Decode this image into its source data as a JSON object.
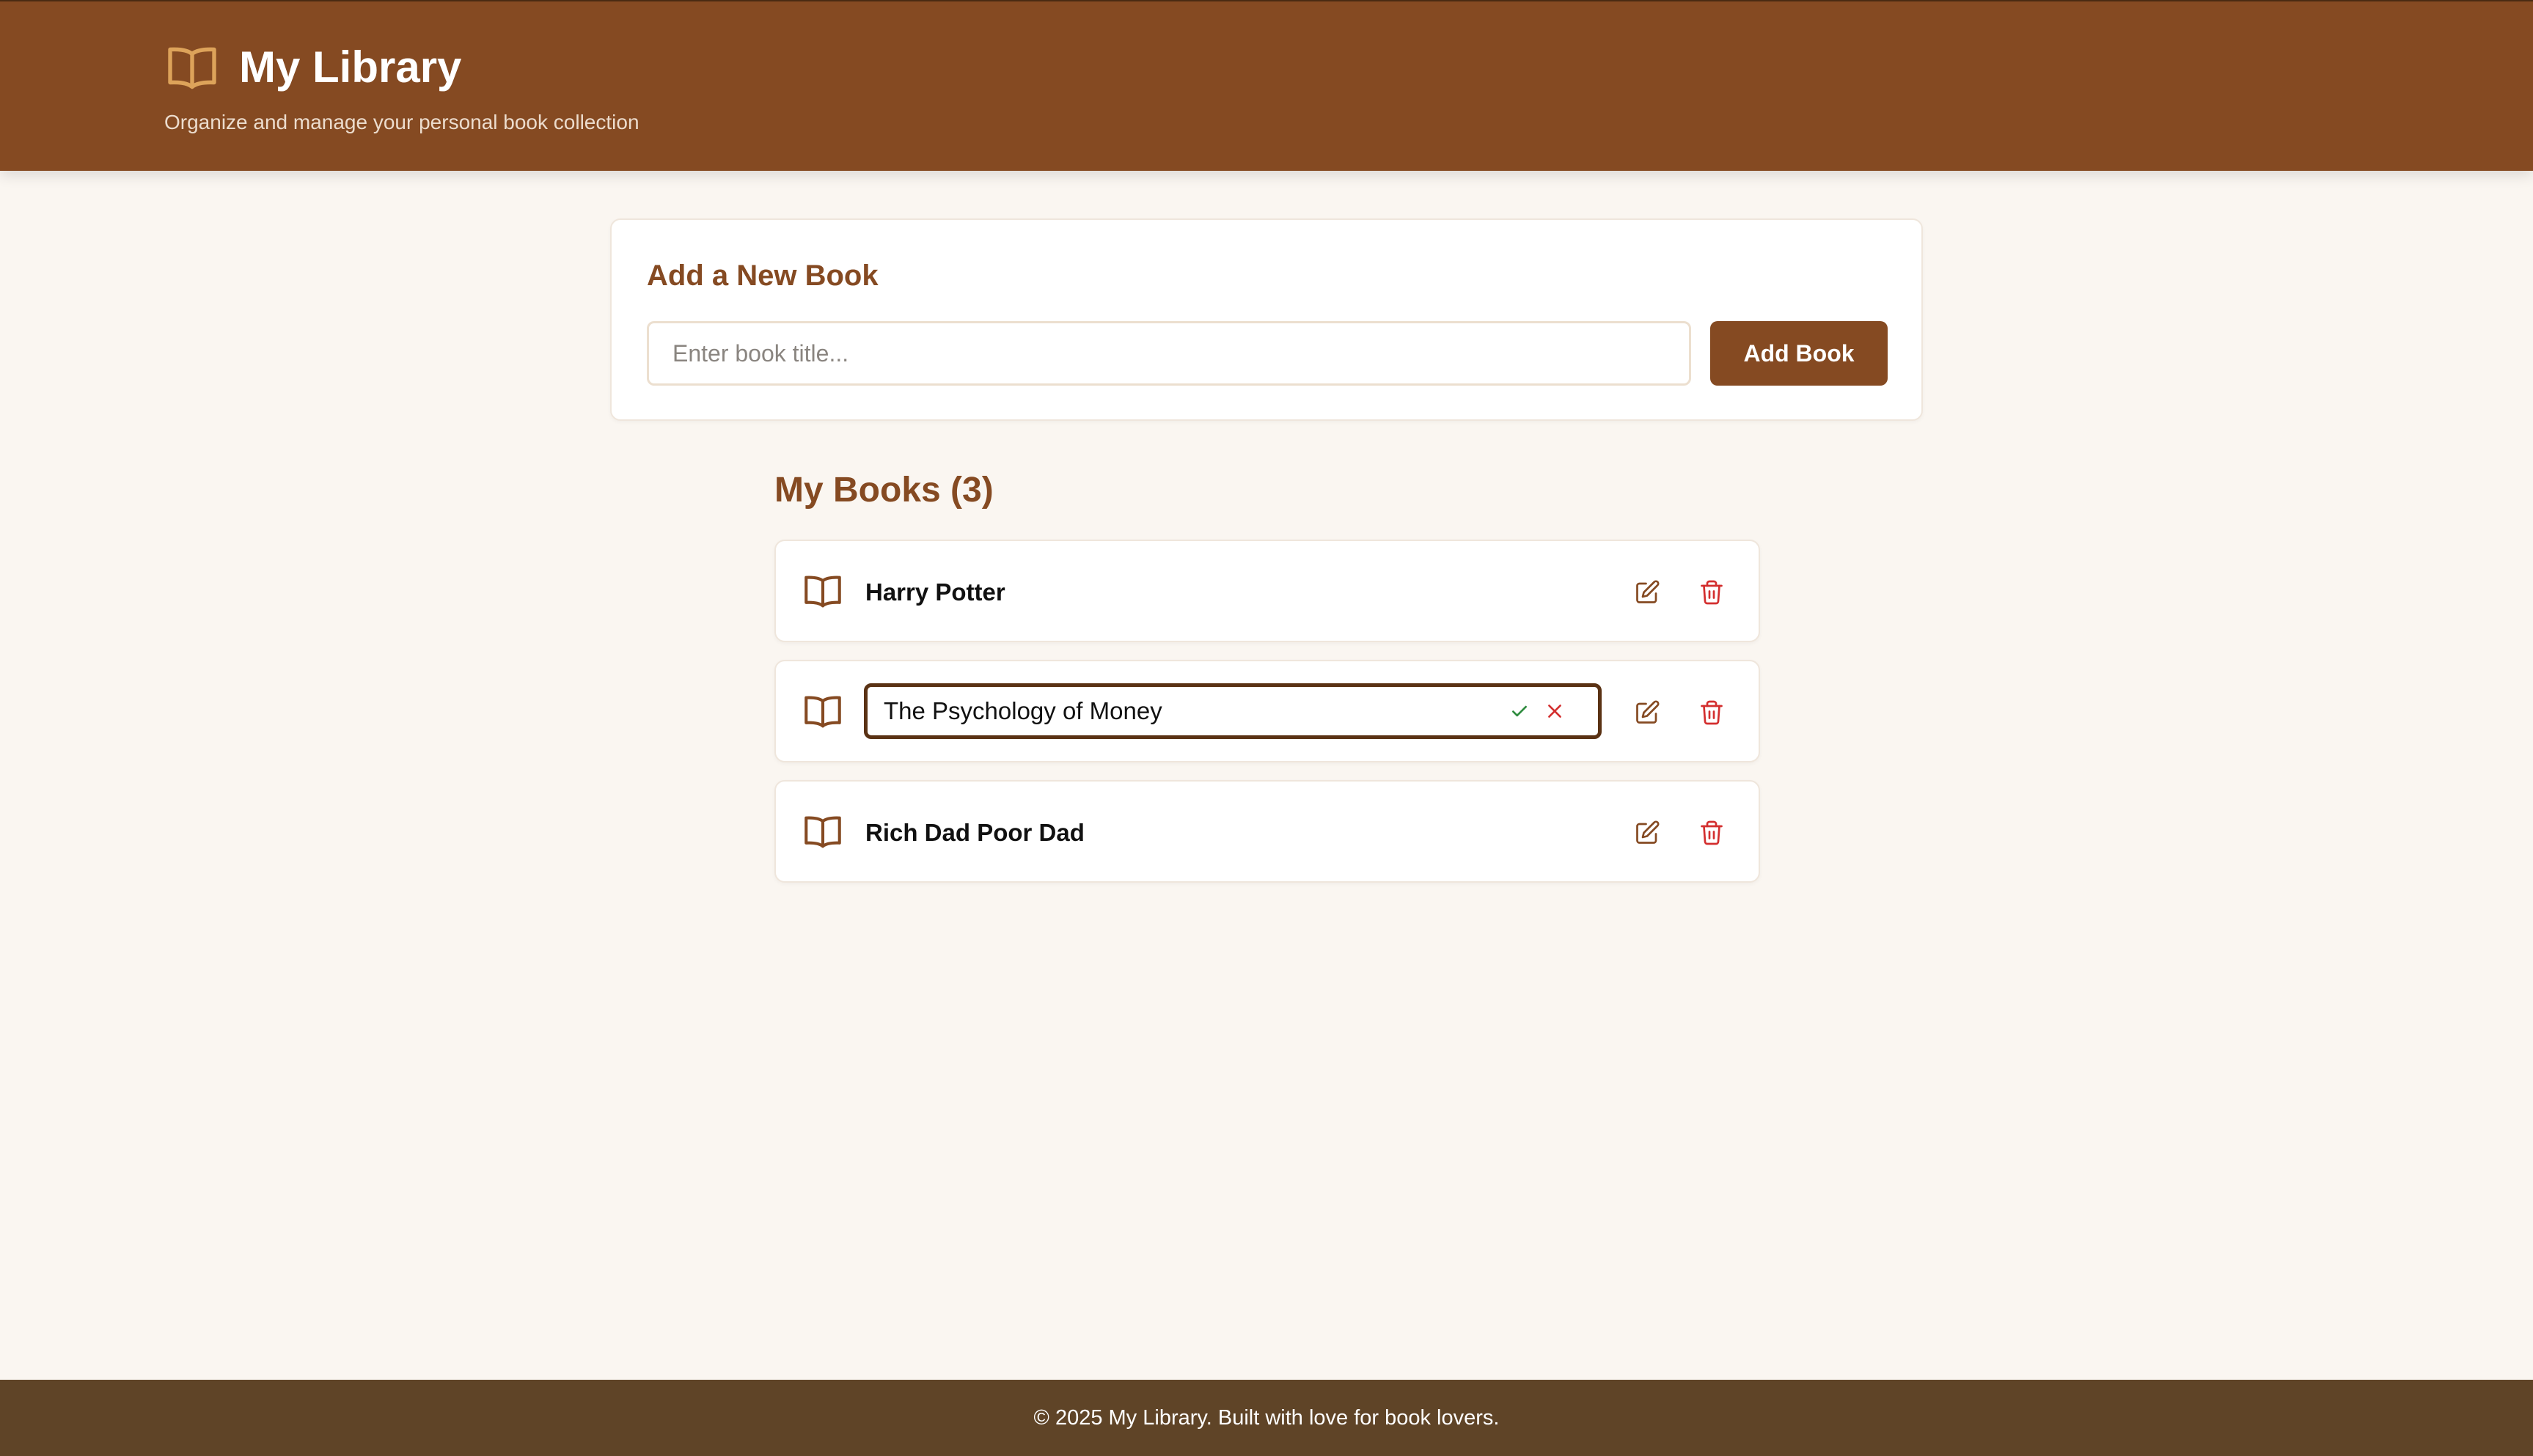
{
  "header": {
    "title": "My Library",
    "subtitle": "Organize and manage your personal book collection",
    "icon": "open-book-icon",
    "accent_color": "#dda35a"
  },
  "add_book": {
    "heading": "Add a New Book",
    "input_placeholder": "Enter book title...",
    "input_value": "",
    "button_label": "Add Book"
  },
  "books_section": {
    "heading": "My Books (3)"
  },
  "books": [
    {
      "title": "Harry Potter",
      "editing": false
    },
    {
      "title": "The Psychology of Money",
      "editing": true
    },
    {
      "title": "Rich Dad Poor Dad",
      "editing": false
    }
  ],
  "icons": {
    "book": "open-book-icon",
    "edit": "pencil-square-icon",
    "delete": "trash-icon",
    "confirm": "check-icon",
    "cancel": "close-icon"
  },
  "colors": {
    "brand": "#854a22",
    "background": "#faf6f1",
    "footer": "#5f4427",
    "delete": "#d32f2f",
    "confirm": "#2e8b3e"
  },
  "footer": {
    "text": "© 2025 My Library. Built with love for book lovers."
  }
}
